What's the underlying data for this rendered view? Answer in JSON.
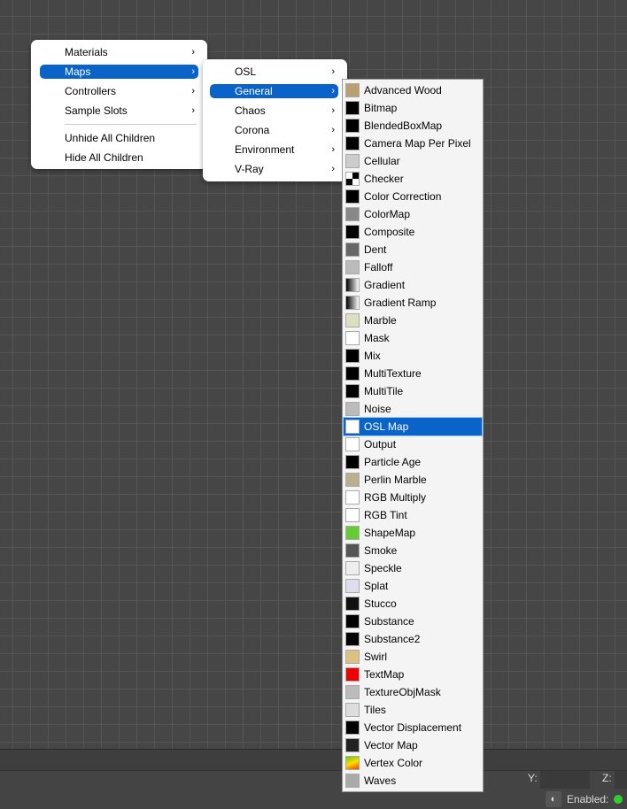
{
  "menu1": {
    "items": [
      {
        "label": "Materials",
        "sub": true
      },
      {
        "label": "Maps",
        "sub": true,
        "selected": true
      },
      {
        "label": "Controllers",
        "sub": true
      },
      {
        "label": "Sample Slots",
        "sub": true
      },
      {
        "label": "Unhide All Children"
      },
      {
        "label": "Hide All Children"
      }
    ]
  },
  "menu2": {
    "items": [
      {
        "label": "OSL"
      },
      {
        "label": "General",
        "selected": true
      },
      {
        "label": "Chaos"
      },
      {
        "label": "Corona"
      },
      {
        "label": "Environment"
      },
      {
        "label": "V-Ray"
      }
    ]
  },
  "arrow": "›",
  "maps": [
    {
      "label": "Advanced Wood",
      "color": "#b8a070"
    },
    {
      "label": "Bitmap",
      "color": "#000"
    },
    {
      "label": "BlendedBoxMap",
      "color": "#000"
    },
    {
      "label": "Camera Map Per Pixel",
      "color": "#000"
    },
    {
      "label": "Cellular",
      "color": "#ccc"
    },
    {
      "label": "Checker",
      "color": "checker"
    },
    {
      "label": "Color Correction",
      "color": "#000"
    },
    {
      "label": "ColorMap",
      "color": "#888"
    },
    {
      "label": "Composite",
      "color": "#000"
    },
    {
      "label": "Dent",
      "color": "#666"
    },
    {
      "label": "Falloff",
      "color": "#bbb"
    },
    {
      "label": "Gradient",
      "color": "grad"
    },
    {
      "label": "Gradient Ramp",
      "color": "grad"
    },
    {
      "label": "Marble",
      "color": "#dde0c0"
    },
    {
      "label": "Mask",
      "color": "#fff"
    },
    {
      "label": "Mix",
      "color": "#000"
    },
    {
      "label": "MultiTexture",
      "color": "#000"
    },
    {
      "label": "MultiTile",
      "color": "#000"
    },
    {
      "label": "Noise",
      "color": "#bbb"
    },
    {
      "label": "OSL Map",
      "color": "#fff",
      "selected": true
    },
    {
      "label": "Output",
      "color": "#fff"
    },
    {
      "label": "Particle Age",
      "color": "#000"
    },
    {
      "label": "Perlin Marble",
      "color": "#b9b090"
    },
    {
      "label": "RGB Multiply",
      "color": "#fff"
    },
    {
      "label": "RGB Tint",
      "color": "#fff"
    },
    {
      "label": "ShapeMap",
      "color": "#6c3"
    },
    {
      "label": "Smoke",
      "color": "#555"
    },
    {
      "label": "Speckle",
      "color": "#eee"
    },
    {
      "label": "Splat",
      "color": "#dde"
    },
    {
      "label": "Stucco",
      "color": "#111"
    },
    {
      "label": "Substance",
      "color": "#000"
    },
    {
      "label": "Substance2",
      "color": "#000"
    },
    {
      "label": "Swirl",
      "color": "#e0c080"
    },
    {
      "label": "TextMap",
      "color": "#e00"
    },
    {
      "label": "TextureObjMask",
      "color": "#bbb"
    },
    {
      "label": "Tiles",
      "color": "#ddd"
    },
    {
      "label": "Vector Displacement",
      "color": "#000"
    },
    {
      "label": "Vector Map",
      "color": "#222"
    },
    {
      "label": "Vertex Color",
      "color": "vc"
    },
    {
      "label": "Waves",
      "color": "#aaa"
    }
  ],
  "status": {
    "y_label": "Y:",
    "z_label": "Z:",
    "enabled_label": "Enabled:"
  }
}
